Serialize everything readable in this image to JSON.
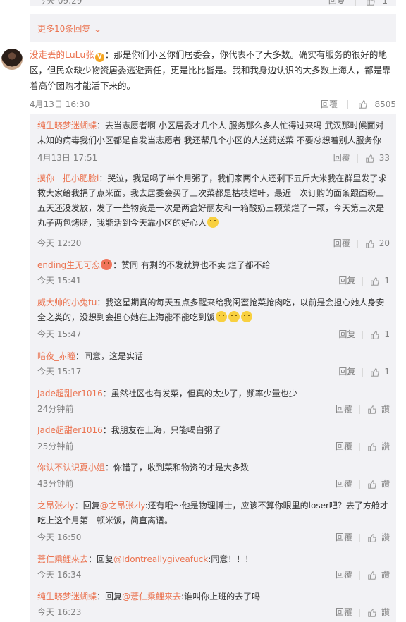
{
  "top_clipped": {
    "time": "今天 09:29",
    "reply_label": "回复",
    "likes": "1"
  },
  "more_replies": {
    "label": "更多10条回复"
  },
  "main_comment": {
    "user": "没走丢的LuLu张",
    "text": "：那是你们小区你们居委会，你代表不了大多数。确实有服务的很好的地区，但民众缺少物资居委逃避责任，更是比比皆是。我和我身边认识的大多数上海人，都是靠着高价团购才能活下来的。",
    "time": "4月13日 16:30",
    "reply_label": "回覆",
    "likes": "8505"
  },
  "replies": [
    {
      "user": "纯生晓梦迷蝴蝶",
      "text": "：去当志愿者啊 小区居委才几个人 服务那么多人忙得过来吗 武汉那时候面对未知的病毒我们小区都是自发当志愿者 我还帮几个小区的人送药送菜 不要总想着别人服务你",
      "time": "4月13日 17:51",
      "reply": "回覆",
      "likes": "33"
    },
    {
      "user": "摸你一把小肥脸i",
      "text": "：哭泣，我是喝了半个月粥了，我们家两个人还剩下五斤大米我在群里发了求救大家给我捐了点米面，我去居委会买了三次菜都是枯枝烂叶，最近一次订购的面条跟面粉三五天还没发放，发了一些物资是一次是两盒好丽友和一箱酸奶三颗菜烂了一颗，今天第三次是丸子两包烤肠，我能活到今天靠小区的好心人",
      "time": "今天 12:20",
      "reply": "回覆",
      "likes": "20"
    },
    {
      "user": "ending生无可恋",
      "text": "：赞同 有剩的不发就算也不卖 烂了都不给",
      "time": "今天 15:41",
      "reply": "回复",
      "likes": "1"
    },
    {
      "user": "威大帅的小兔tu",
      "text": "：我这星期真的每天五点多醒来给我闺蜜抢菜抢肉吃，以前是会担心她人身安全之类的，没想到会担心她在上海能不能吃到饭",
      "time": "今天 15:47",
      "reply": "回复",
      "likes": "1"
    },
    {
      "user": "暗夜_赤瞳",
      "text": "：同意，这是实话",
      "time": "今天 15:17",
      "reply": "回复",
      "likes": "1"
    },
    {
      "user": "Jade超甜er1016",
      "text": "：虽然社区也有发菜，但真的太少了，频率少量也少",
      "time": "24分钟前",
      "reply": "回覆",
      "likes": "讚"
    },
    {
      "user": "Jade超甜er1016",
      "text": "：我朋友在上海，只能喝白粥了",
      "time": "25分钟前",
      "reply": "回覆",
      "likes": "讚"
    },
    {
      "user": "你认不认识夏小姐",
      "text": "：你错了，收到菜和物资的才是大多数",
      "time": "43分钟前",
      "reply": "回覆",
      "likes": "讚"
    },
    {
      "user": "之昂张zly",
      "prefix": "：回复",
      "at": "@之昂张zly",
      "text": ":还有哦～他是物理博士，应该不算你眼里的loser吧？去了方舱才吃上这个月第一顿米饭，简直离谱。",
      "time": "今天 16:50",
      "reply": "回覆",
      "likes": "讚"
    },
    {
      "user": "薏仁乘鲤来去",
      "prefix": "：回复",
      "at": "@Idontreallygiveafuck",
      "text": ":同意！！！",
      "time": "今天 16:34",
      "reply": "回覆",
      "likes": "讚"
    },
    {
      "user": "纯生晓梦迷蝴蝶",
      "prefix": "：回复",
      "at": "@薏仁乘鲤来去",
      "text": ":谁叫你上班的去了吗",
      "time": "今天 16:23",
      "reply": "回覆",
      "likes": "讚"
    }
  ]
}
